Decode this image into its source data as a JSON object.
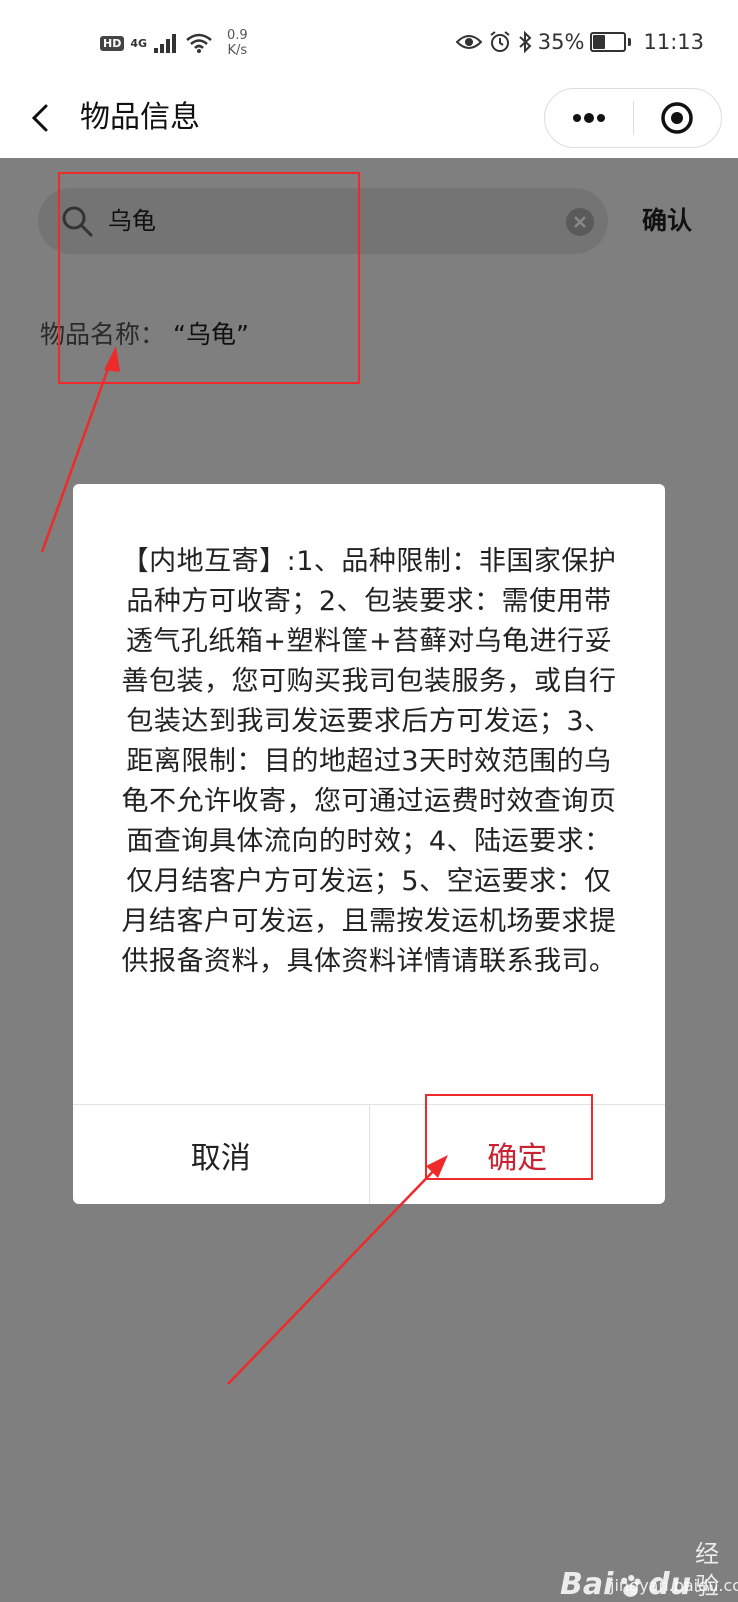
{
  "status_bar": {
    "hd": "HD",
    "network": "4G",
    "speed_value": "0.9",
    "speed_unit": "K/s",
    "battery": "35%",
    "time": "11:13"
  },
  "header": {
    "title": "物品信息",
    "back_icon": "chevron-left-icon",
    "more_icon": "more-dots-icon",
    "close_icon": "target-circle-icon"
  },
  "search": {
    "value": "乌龟",
    "confirm_label": "确认"
  },
  "item": {
    "label": "物品名称：",
    "value": "“乌龟”"
  },
  "dialog": {
    "message": "【内地互寄】:1、品种限制：非国家保护品种方可收寄；2、包装要求：需使用带透气孔纸箱+塑料筐+苔藓对乌龟进行妥善包装，您可购买我司包装服务，或自行包装达到我司发运要求后方可发运；3、距离限制：目的地超过3天时效范围的乌龟不允许收寄，您可通过运费时效查询页面查询具体流向的时效；4、陆运要求：仅月结客户方可发运；5、空运要求：仅月结客户可发运，且需按发运机场要求提供报备资料，具体资料详情请联系我司。",
    "cancel_label": "取消",
    "ok_label": "确定",
    "ok_color": "#c82233"
  },
  "watermark": {
    "logo": "Bai",
    "logo_suffix": "du",
    "brand_cn": "经验",
    "url": "jingyan.baidu.com"
  },
  "colors": {
    "overlay": "#7f7f7f",
    "annotation": "#ee2a2a"
  }
}
